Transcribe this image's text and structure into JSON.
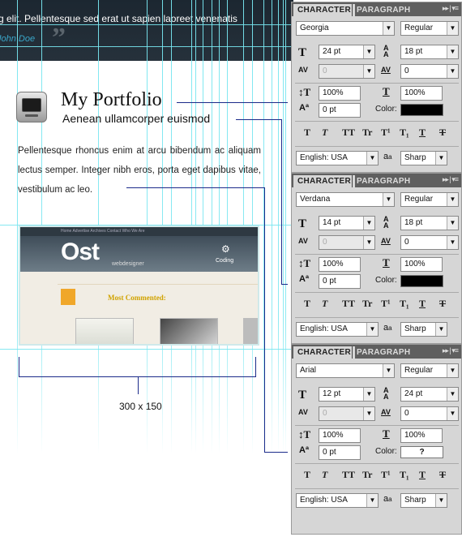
{
  "header": {
    "quote_text": "g elit. Pellentesque sed erat ut sapien laoreet venenatis",
    "author": "John Doe",
    "quote_mark": "”"
  },
  "portfolio": {
    "title": "My Portfolio",
    "subtitle": "Aenean ullamcorper euismod",
    "body": "Pellentesque rhoncus enim at arcu bibendum ac aliquam lectus semper. Integer nibh eros, porta eget dapibus vitae, vestibulum ac leo.",
    "dimension": "300 x 150"
  },
  "screenshot": {
    "nav_items": "Home    Advertise    Archives    Contact    Who We Are",
    "logo": "st",
    "logo_sub": "webdesigner",
    "coding": "Coding",
    "most_commented": "Most Commented:"
  },
  "panels": [
    {
      "tab_active": "CHARACTER",
      "tab_inactive": "PARAGRAPH",
      "menu": "▸▸ | ▾≡",
      "font_family": "Georgia",
      "font_style": "Regular",
      "font_size": "24 pt",
      "leading": "18 pt",
      "kerning": "0",
      "tracking": "0",
      "vertical_scale": "100%",
      "horizontal_scale": "100%",
      "baseline_shift": "0 pt",
      "color_label": "Color:",
      "color_value": "",
      "language": "English: USA",
      "aa_label": "a",
      "antialias": "Sharp",
      "color_hex": "#000000"
    },
    {
      "tab_active": "CHARACTER",
      "tab_inactive": "PARAGRAPH",
      "menu": "▸▸ | ▾≡",
      "font_family": "Verdana",
      "font_style": "Regular",
      "font_size": "14 pt",
      "leading": "18 pt",
      "kerning": "0",
      "tracking": "0",
      "vertical_scale": "100%",
      "horizontal_scale": "100%",
      "baseline_shift": "0 pt",
      "color_label": "Color:",
      "color_value": "",
      "language": "English: USA",
      "aa_label": "a",
      "antialias": "Sharp",
      "color_hex": "#000000"
    },
    {
      "tab_active": "CHARACTER",
      "tab_inactive": "PARAGRAPH",
      "menu": "▸▸ | ▾≡",
      "font_family": "Arial",
      "font_style": "Regular",
      "font_size": "12 pt",
      "leading": "24 pt",
      "kerning": "0",
      "tracking": "0",
      "vertical_scale": "100%",
      "horizontal_scale": "100%",
      "baseline_shift": "0 pt",
      "color_label": "Color:",
      "color_value": "?",
      "language": "English: USA",
      "aa_label": "a",
      "antialias": "Sharp",
      "color_hex": "#ffffff"
    }
  ],
  "style_buttons": [
    "T",
    "T",
    "TT",
    "Tr",
    "T¹",
    "T₁",
    "T",
    "T"
  ]
}
